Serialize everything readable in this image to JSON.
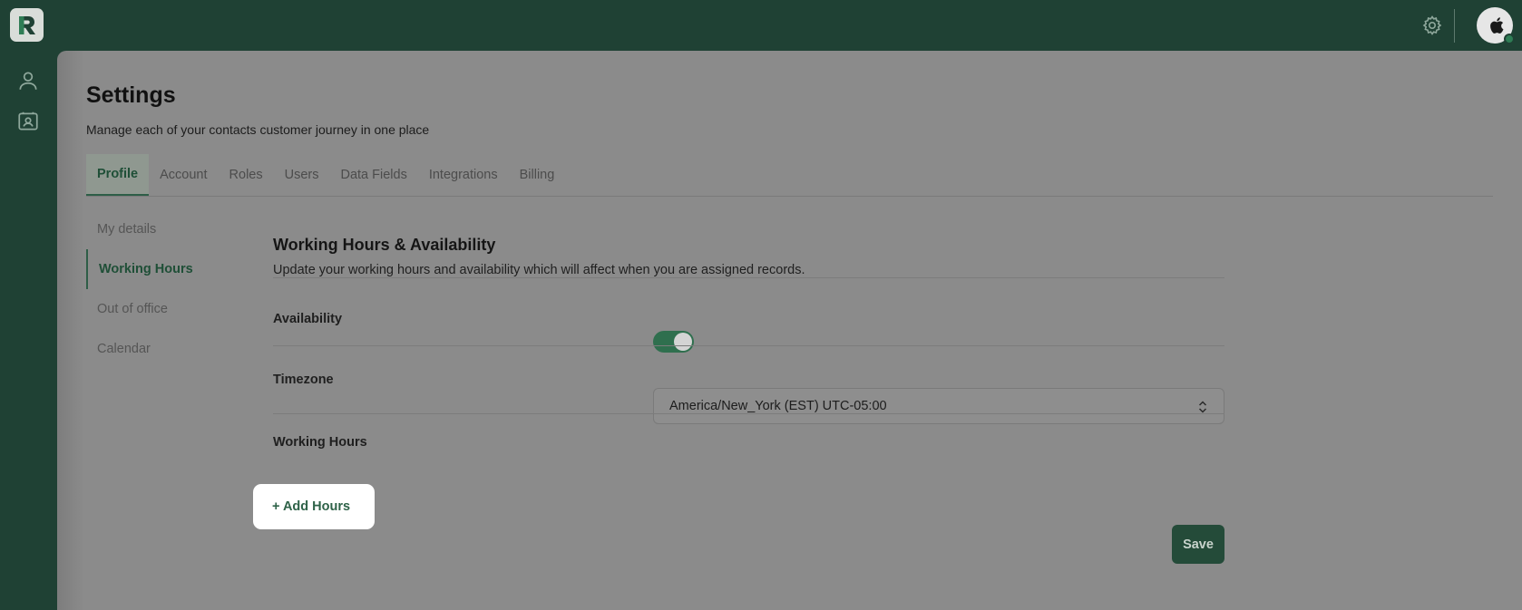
{
  "app": {
    "logo_letter": "R",
    "colors": {
      "brand": "#1f4134",
      "accent": "#2f6f4e",
      "overlay_bg": "#8b8b8b"
    }
  },
  "header": {
    "settings_icon": "gear-icon",
    "avatar_icon": "apple-icon"
  },
  "sidebar": {
    "icons": [
      "user-icon",
      "contacts-card-icon"
    ]
  },
  "page": {
    "title": "Settings",
    "subtitle": "Manage each of your contacts customer journey in one place"
  },
  "tabs": [
    {
      "label": "Profile",
      "active": true
    },
    {
      "label": "Account",
      "active": false
    },
    {
      "label": "Roles",
      "active": false
    },
    {
      "label": "Users",
      "active": false
    },
    {
      "label": "Data Fields",
      "active": false
    },
    {
      "label": "Integrations",
      "active": false
    },
    {
      "label": "Billing",
      "active": false
    }
  ],
  "subnav": [
    {
      "label": "My details",
      "active": false
    },
    {
      "label": "Working Hours",
      "active": true
    },
    {
      "label": "Out of office",
      "active": false
    },
    {
      "label": "Calendar",
      "active": false
    }
  ],
  "section": {
    "title": "Working Hours & Availability",
    "description": "Update your working hours and availability which will affect when you are assigned records.",
    "availability_label": "Availability",
    "availability_on": true,
    "timezone_label": "Timezone",
    "timezone_value": "America/New_York (EST) UTC-05:00",
    "working_hours_label": "Working Hours",
    "add_hours_label": "+ Add Hours",
    "save_label": "Save"
  }
}
